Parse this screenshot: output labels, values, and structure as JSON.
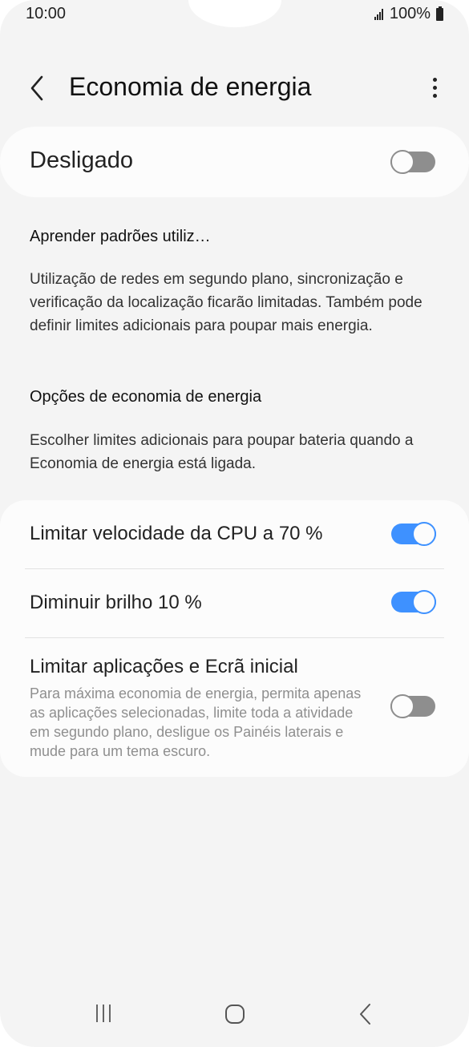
{
  "status_bar": {
    "time": "10:00",
    "battery": "100%"
  },
  "header": {
    "title": "Economia de energia"
  },
  "master_switch": {
    "label": "Desligado",
    "state": "off"
  },
  "section_adaptive": {
    "heading": "Aprender padrões utiliz…",
    "text": "Utilização de redes em segundo plano, sincronização e verificação da localização ficarão limitadas. Também pode definir limites adicionais para poupar mais energia."
  },
  "section_options": {
    "heading": "Opções de economia de energia",
    "text": "Escolher limites adicionais para poupar bateria quando a Economia de energia está ligada."
  },
  "options": [
    {
      "label": "Limitar velocidade da CPU a 70 %",
      "state": "on"
    },
    {
      "label": "Diminuir brilho 10 %",
      "state": "on"
    },
    {
      "label": "Limitar aplicações e Ecrã inicial",
      "description": "Para máxima economia de energia, permita apenas as aplicações selecionadas, limite toda a atividade em segundo plano, desligue os Painéis laterais e mude para um tema escuro.",
      "state": "off"
    }
  ],
  "colors": {
    "accent": "#3e91ff",
    "toggle_off": "#8e8e8e",
    "background": "#f4f4f4",
    "card": "#fcfcfc"
  }
}
